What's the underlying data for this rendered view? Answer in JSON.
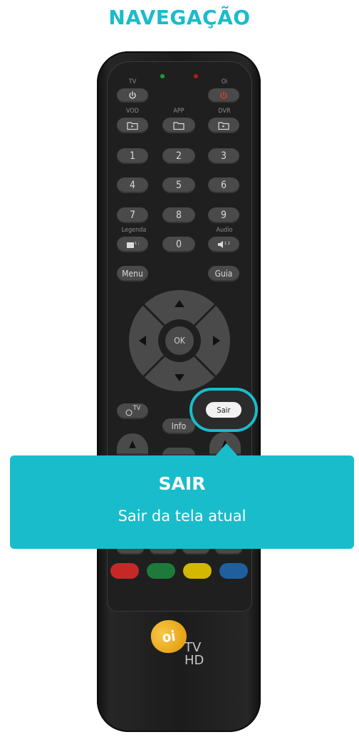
{
  "page_title": "NAVEGAÇÃO",
  "remote": {
    "labels": {
      "tv": "TV",
      "oi": "Oi",
      "vod": "VOD",
      "app": "APP",
      "dvr": "DVR",
      "legenda": "Legenda",
      "audio": "Audio"
    },
    "numbers": [
      "1",
      "2",
      "3",
      "4",
      "5",
      "6",
      "7",
      "8",
      "9",
      "0"
    ],
    "menu": "Menu",
    "guia": "Guia",
    "ok": "OK",
    "info": "Info",
    "sair": "Sair",
    "tv_button": "TV",
    "logo": {
      "brand": "oi",
      "tv": "TV",
      "hd": "HD"
    },
    "color_buttons": [
      "#c62828",
      "#1e7a3a",
      "#d4b800",
      "#1f5f9e"
    ]
  },
  "callout": {
    "title": "SAIR",
    "description": "Sair da tela atual"
  },
  "colors": {
    "accent": "#19bccb",
    "remote_body": "#1c1c1c",
    "button": "#4a4a4a",
    "led_green": "#1f9a3c",
    "led_red": "#b71c1c",
    "power_red": "#e53935"
  },
  "icons": {
    "power": "power-icon",
    "vod": "folder-play-icon",
    "app": "folder-icon",
    "dvr": "folder-play-icon",
    "legenda": "subtitle-icon",
    "audio": "speaker-icon"
  }
}
